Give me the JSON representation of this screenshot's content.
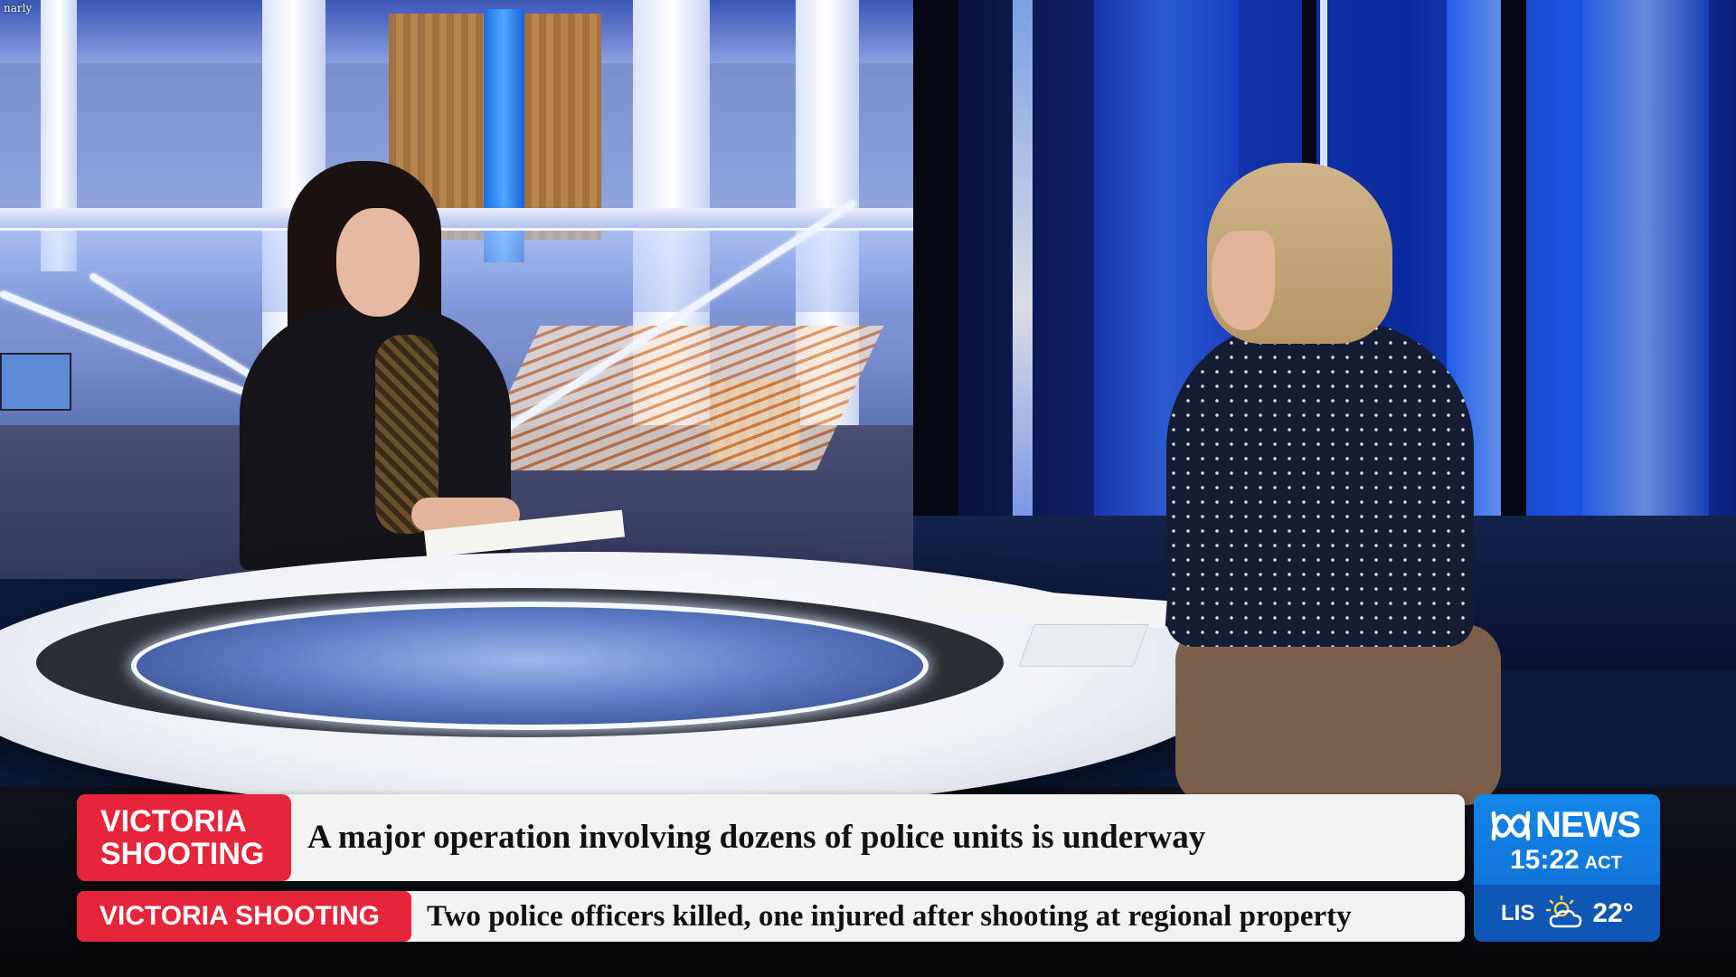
{
  "watermark": "narly",
  "lower_third": {
    "primary": {
      "tag_line1": "VICTORIA",
      "tag_line2": "SHOOTING",
      "headline": "A major operation involving dozens of police units is underway",
      "tag_color": "#e6243a"
    },
    "secondary": {
      "tag": "VICTORIA SHOOTING",
      "headline": "Two police officers killed, one injured after shooting at regional property",
      "tag_color": "#e6243a"
    }
  },
  "bug": {
    "brand": "NEWS",
    "logo_icon": "abc-lissajous-logo",
    "time": "15:22",
    "timezone": "ACT",
    "city": "LIS",
    "weather_icon": "sun-behind-cloud-icon",
    "temperature": "22°",
    "bg_color": "#1486e6"
  }
}
